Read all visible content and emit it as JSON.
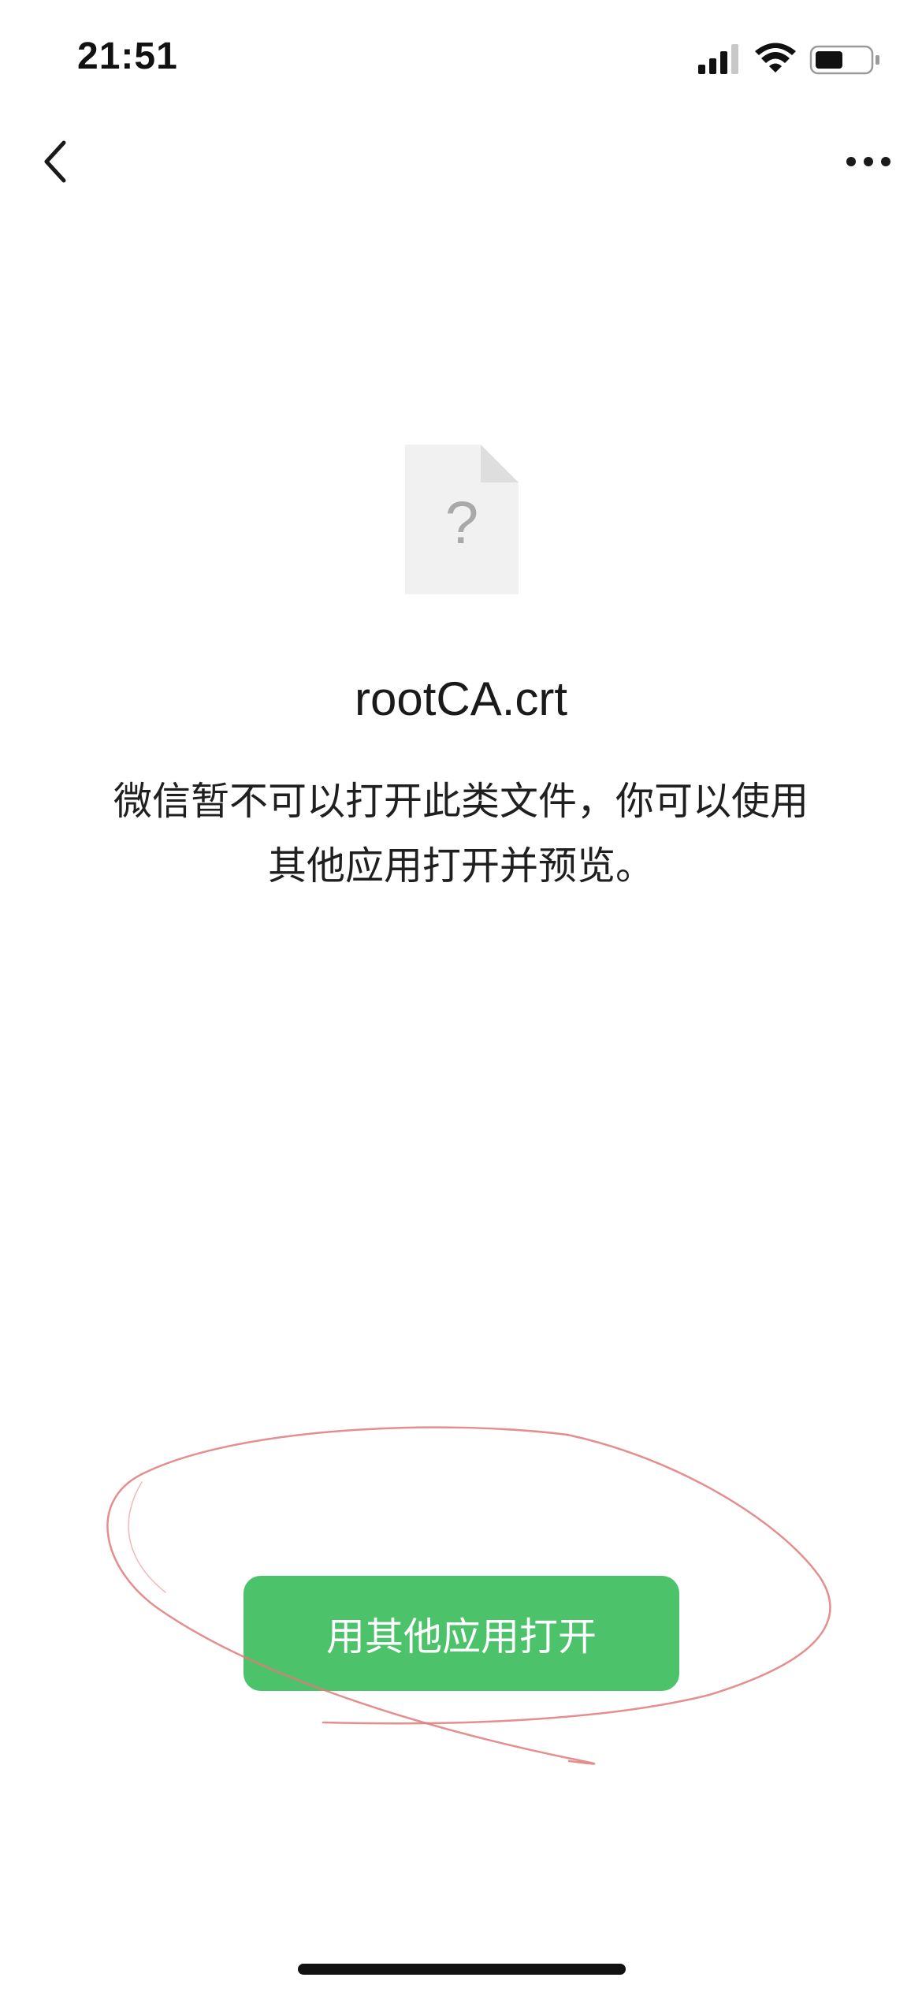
{
  "status_bar": {
    "time": "21:51",
    "icons": [
      "cellular-signal-icon",
      "wifi-icon",
      "battery-icon"
    ]
  },
  "nav": {
    "back_icon": "chevron-left-icon",
    "more_icon": "more-dots-icon"
  },
  "file": {
    "icon": "unknown-file-icon",
    "icon_glyph": "?",
    "name": "rootCA.crt"
  },
  "message": {
    "line1": "微信暂不可以打开此类文件，你可以使用",
    "line2": "其他应用打开并预览。"
  },
  "actions": {
    "open_with_other_app_label": "用其他应用打开",
    "button_color": "#4cc26a"
  },
  "annotation": {
    "type": "hand-drawn-red-circle",
    "color": "#e07a7a"
  }
}
